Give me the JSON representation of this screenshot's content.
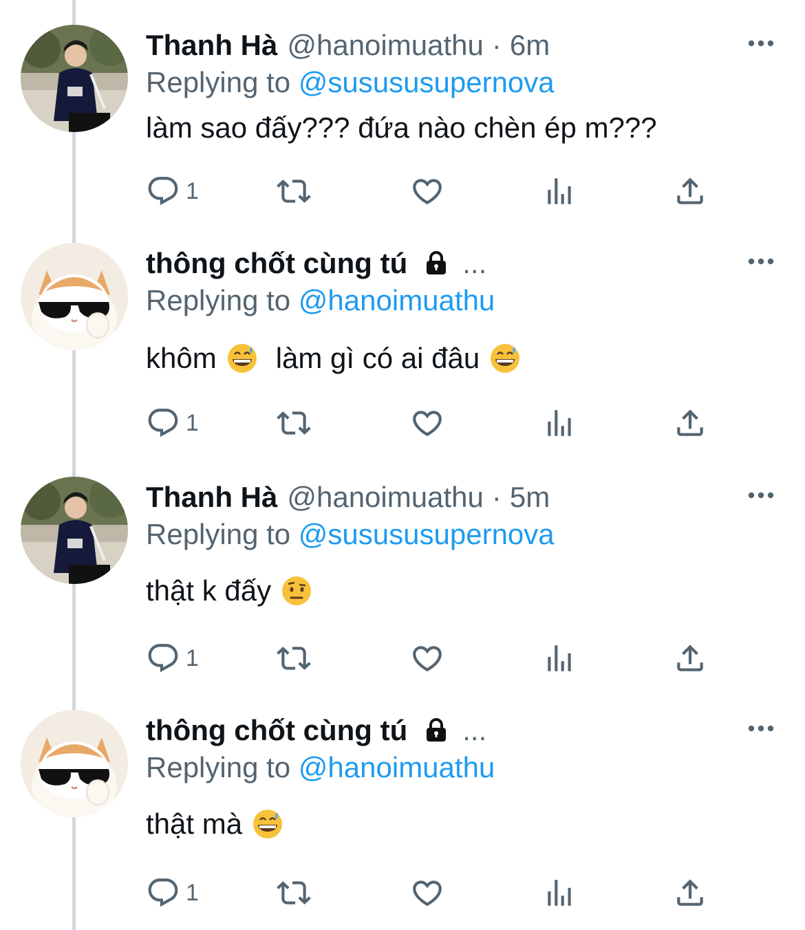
{
  "tweets": [
    {
      "name": "Thanh Hà",
      "handle": "@hanoimuathu",
      "dot": "·",
      "time": "6m",
      "replying_prefix": "Replying to",
      "replying_to": "@susususupernova",
      "text": "làm sao đấy??? đứa nào chèn ép m???",
      "emojis": [],
      "reply_count": "1",
      "avatar": "boy-photo",
      "locked": false
    },
    {
      "name": "thông chốt cùng tú",
      "ellipsis": "...",
      "replying_prefix": "Replying to",
      "replying_to": "@hanoimuathu",
      "text_part1": "khôm",
      "text_part2": "làm gì có ai đâu",
      "emojis": [
        "grinning-sweat-emoji",
        "grinning-sweat-emoji"
      ],
      "reply_count": "1",
      "avatar": "cat-sunglasses",
      "locked": true
    },
    {
      "name": "Thanh Hà",
      "handle": "@hanoimuathu",
      "dot": "·",
      "time": "5m",
      "replying_prefix": "Replying to",
      "replying_to": "@susususupernova",
      "text": "thật k đấy",
      "emojis": [
        "raised-eyebrow-emoji"
      ],
      "reply_count": "1",
      "avatar": "boy-photo",
      "locked": false
    },
    {
      "name": "thông chốt cùng tú",
      "ellipsis": "...",
      "replying_prefix": "Replying to",
      "replying_to": "@hanoimuathu",
      "text": "thật mà",
      "emojis": [
        "grinning-sweat-emoji"
      ],
      "reply_count": "1",
      "avatar": "cat-sunglasses",
      "locked": true
    }
  ],
  "icons": [
    "reply-icon",
    "retweet-icon",
    "like-icon",
    "views-icon",
    "share-icon",
    "more-icon",
    "lock-icon"
  ],
  "colors": {
    "link": "#1d9bf0",
    "secondary": "#536471",
    "text": "#0f1419",
    "thread_line": "#cfd9de"
  }
}
